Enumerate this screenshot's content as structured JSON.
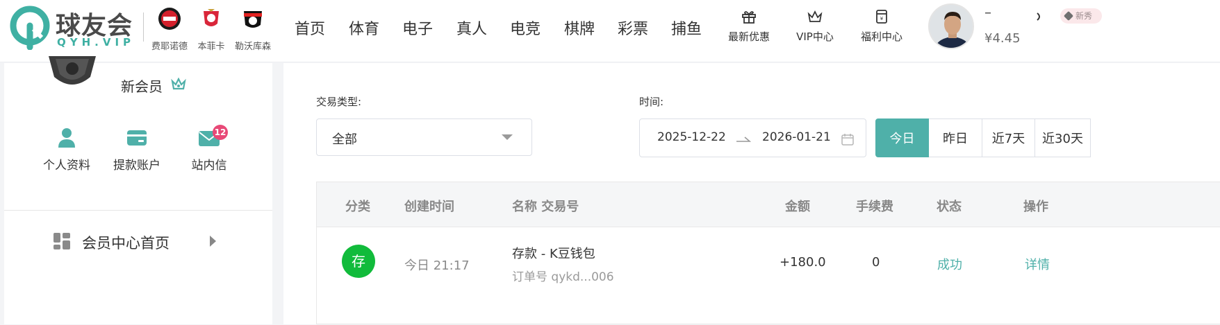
{
  "brand": {
    "name": "球友会",
    "domain": "QYH.VIP",
    "accent": "#3fb0a3"
  },
  "clubs": [
    "费耶诺德",
    "本菲卡",
    "勒沃库森"
  ],
  "nav": [
    "首页",
    "体育",
    "电子",
    "真人",
    "电竞",
    "棋牌",
    "彩票",
    "捕鱼"
  ],
  "quick_links": [
    {
      "label": "最新优惠",
      "icon": "gift-icon"
    },
    {
      "label": "VIP中心",
      "icon": "crown-icon"
    },
    {
      "label": "福利中心",
      "icon": "welfare-icon"
    }
  ],
  "user": {
    "balance": "¥4.45",
    "vip_tag": "新秀"
  },
  "sidebar": {
    "member_level": "新会员",
    "actions": [
      {
        "label": "个人资料",
        "icon": "person-icon"
      },
      {
        "label": "提款账户",
        "icon": "card-icon"
      },
      {
        "label": "站内信",
        "icon": "mail-icon",
        "badge": "12"
      }
    ],
    "home_link": "会员中心首页"
  },
  "filters": {
    "type_label": "交易类型:",
    "type_value": "全部",
    "time_label": "时间:",
    "date_start": "2025-12-22",
    "date_end": "2026-01-21",
    "quick_ranges": [
      "今日",
      "昨日",
      "近7天",
      "近30天"
    ],
    "active_range": "今日"
  },
  "table": {
    "headers": [
      "分类",
      "创建时间",
      "名称 交易号",
      "金额",
      "手续费",
      "状态",
      "操作"
    ],
    "rows": [
      {
        "category": "存",
        "created": "今日 21:17",
        "name": "存款 - K豆钱包",
        "order": "订单号 qykd...006",
        "amount": "+180.0",
        "fee": "0",
        "status": "成功",
        "action": "详情"
      }
    ]
  },
  "colors": {
    "accent": "#4fb0a9",
    "deposit": "#11bb3b",
    "badge": "#e84977"
  }
}
